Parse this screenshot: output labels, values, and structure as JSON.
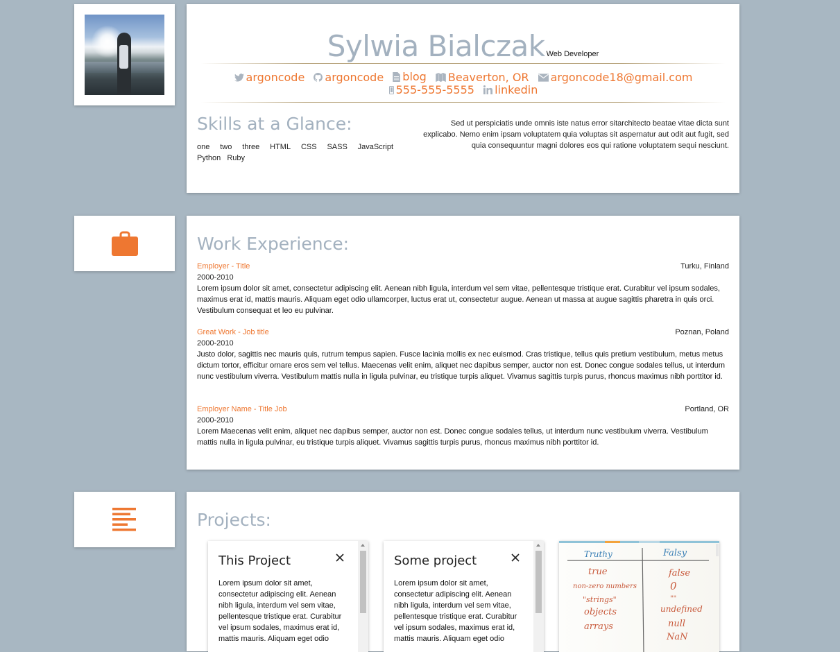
{
  "header": {
    "name": "Sylwia Bialczak",
    "role": "Web Developer",
    "links": [
      {
        "icon": "twitter-icon",
        "label": "argoncode"
      },
      {
        "icon": "github-icon",
        "label": "argoncode"
      },
      {
        "icon": "document-icon",
        "label": "blog"
      },
      {
        "icon": "map-icon",
        "label": "Beaverton, OR"
      },
      {
        "icon": "envelope-icon",
        "label": "argoncode18@gmail.com"
      },
      {
        "icon": "mobile-phone-icon",
        "label": "555-555-5555"
      },
      {
        "icon": "linkedin-icon",
        "label": "linkedin"
      }
    ],
    "skills_title": "Skills at a Glance:",
    "skills": [
      "one",
      "two",
      "three",
      "HTML",
      "CSS",
      "SASS",
      "JavaScript",
      "Python",
      "Ruby"
    ],
    "summary": "Sed ut perspiciatis unde omnis iste natus error sitarchitecto beatae vitae dicta sunt explicabo. Nemo enim ipsam voluptatem quia voluptas sit aspernatur aut odit aut fugit, sed quia consequuntur magni dolores eos qui ratione voluptatem sequi nesciunt."
  },
  "work": {
    "icon": "briefcase-icon",
    "title": "Work Experience:",
    "jobs": [
      {
        "title": "Employer - Title",
        "location": "Turku, Finland",
        "dates": "2000-2010",
        "description": "Lorem ipsum dolor sit amet, consectetur adipiscing elit. Aenean nibh ligula, interdum vel sem vitae, pellentesque tristique erat. Curabitur vel ipsum sodales, maximus erat id, mattis mauris. Aliquam eget odio ullamcorper, luctus erat ut, consectetur augue. Aenean ut massa at augue sagittis pharetra in quis orci. Vestibulum consequat et leo eu pulvinar."
      },
      {
        "title": "Great Work - Job title",
        "location": "Poznan, Poland",
        "dates": "2000-2010",
        "description": "Justo dolor, sagittis nec mauris quis, rutrum tempus sapien. Fusce lacinia mollis ex nec euismod. Cras tristique, tellus quis pretium vestibulum, metus metus dictum tortor, efficitur ornare eros sem vel tellus. Maecenas velit enim, aliquet nec dapibus semper, auctor non est. Donec congue sodales tellus, ut interdum nunc vestibulum viverra. Vestibulum mattis nulla in ligula pulvinar, eu tristique turpis aliquet. Vivamus sagittis turpis purus, rhoncus maximus nibh porttitor id."
      },
      {
        "title": "Employer Name - Title Job",
        "location": "Portland, OR",
        "dates": "2000-2010",
        "description": "Lorem Maecenas velit enim, aliquet nec dapibus semper, auctor non est. Donec congue sodales tellus, ut interdum nunc vestibulum viverra. Vestibulum mattis nulla in ligula pulvinar, eu tristique turpis aliquet. Vivamus sagittis turpis purus, rhoncus maximus nibh porttitor id."
      }
    ]
  },
  "projects": {
    "icon": "align-left-icon",
    "title": "Projects:",
    "cards": [
      {
        "title": "This Project",
        "body": "Lorem ipsum dolor sit amet, consectetur adipiscing elit. Aenean nibh ligula, interdum vel sem vitae, pellentesque tristique erat. Curabitur vel ipsum sodales, maximus erat id, mattis mauris. Aliquam eget odio"
      },
      {
        "title": "Some project",
        "body": "Lorem ipsum dolor sit amet, consectetur adipiscing elit. Aenean nibh ligula, interdum vel sem vitae, pellentesque tristique erat. Curabitur vel ipsum sodales, maximus erat id, mattis mauris. Aliquam eget odio"
      }
    ],
    "image_card": {
      "headers": [
        "Truthy",
        "Falsy"
      ],
      "left": [
        "true",
        "non-zero numbers",
        "\"strings\"",
        "objects",
        "arrays"
      ],
      "right": [
        "false",
        "0",
        "\"\"",
        "undefined",
        "null",
        "NaN"
      ]
    }
  },
  "colors": {
    "accent": "#ee7731",
    "title_gray": "#a3b1bf",
    "background": "#a8b7c2"
  }
}
